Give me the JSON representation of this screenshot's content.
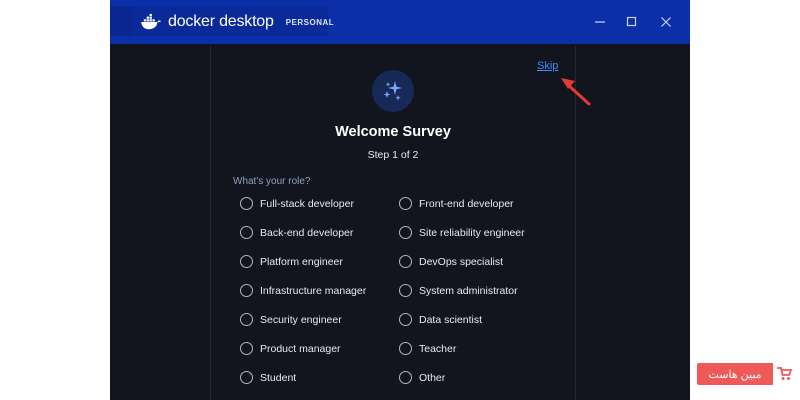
{
  "app": {
    "name": "docker desktop",
    "edition_badge": "PERSONAL"
  },
  "window_controls": {
    "minimize": "minimize-icon",
    "maximize": "maximize-icon",
    "close": "close-icon"
  },
  "survey": {
    "skip_label": "Skip",
    "title": "Welcome Survey",
    "step": "Step 1 of 2",
    "question": "What's your role?",
    "options_left": [
      "Full-stack developer",
      "Back-end developer",
      "Platform engineer",
      "Infrastructure manager",
      "Security engineer",
      "Product manager",
      "Student"
    ],
    "options_right": [
      "Front-end developer",
      "Site reliability engineer",
      "DevOps specialist",
      "System administrator",
      "Data scientist",
      "Teacher",
      "Other"
    ]
  },
  "watermark": {
    "text": "مبین هاست"
  },
  "colors": {
    "titlebar": "#0b2fa8",
    "background": "#12151d",
    "link": "#3b8cff",
    "annotation_arrow": "#e53935",
    "watermark": "#ef5a59"
  }
}
